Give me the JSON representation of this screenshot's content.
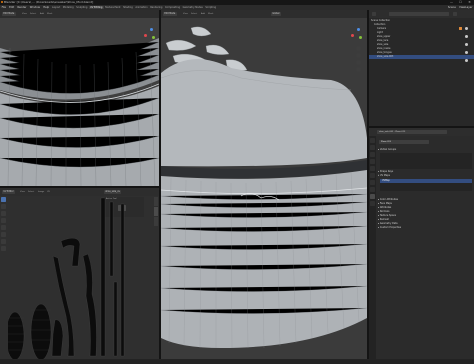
{
  "window": {
    "title": "Blender [C:\\Users\\ ... \\Downloads\\sneaker\\Shoe_Mod.blend]",
    "controls": [
      "—",
      "☐",
      "✕"
    ]
  },
  "menu": [
    "File",
    "Edit",
    "Render",
    "Window",
    "Help"
  ],
  "workspaces": [
    "Layout",
    "Modeling",
    "Sculpting",
    "UV Editing",
    "Texture Paint",
    "Shading",
    "Animation",
    "Rendering",
    "Compositing",
    "Geometry Nodes",
    "Scripting"
  ],
  "active_workspace": "UV Editing",
  "scene": {
    "label": "Scene",
    "view_layer": "ViewLayer"
  },
  "viewport_left": {
    "mode": "Edit Mode",
    "menus": [
      "View",
      "Select",
      "Add",
      "Mesh",
      "Vertex",
      "Edge",
      "Face",
      "UV"
    ],
    "info": "User Perspective",
    "object_info": "(1) shoe_sole.003"
  },
  "viewport_main": {
    "mode": "Edit Mode",
    "menus": [
      "View",
      "Select",
      "Add",
      "Mesh",
      "Vertex",
      "Edge",
      "Face",
      "UV"
    ],
    "shading": "Global"
  },
  "uv_editor": {
    "mode": "UV Editor",
    "menus": [
      "View",
      "Select",
      "Image",
      "UV"
    ],
    "image_name": "shoe_sole_uv",
    "panel_tabs": [
      "Image",
      "Tool",
      "View"
    ],
    "panel_title": "Active Tool"
  },
  "outliner": {
    "search_placeholder": "",
    "rows": [
      {
        "label": "Scene Collection",
        "icon": "collection-icon"
      },
      {
        "label": "Collection",
        "icon": "collection-icon"
      },
      {
        "label": "Camera",
        "icon": "camera-icon"
      },
      {
        "label": "Light",
        "icon": "light-icon"
      },
      {
        "label": "shoe_upper",
        "icon": "mesh-icon"
      },
      {
        "label": "shoe_lace",
        "icon": "mesh-icon"
      },
      {
        "label": "shoe_sole",
        "icon": "mesh-icon"
      },
      {
        "label": "shoe_insole",
        "icon": "mesh-icon"
      },
      {
        "label": "shoe_tongue",
        "icon": "mesh-icon"
      },
      {
        "label": "shoe_sole.003",
        "icon": "mesh-icon"
      }
    ]
  },
  "properties": {
    "breadcrumb": "shoe_sole.003 › Plane.013",
    "data_name": "Plane.013",
    "groups": [
      "Vertex Groups",
      "Shape Keys",
      "UV Maps",
      "Color Attributes",
      "Face Maps",
      "Attributes",
      "Normals",
      "Texture Space",
      "Remesh",
      "Geometry Data",
      "Custom Properties"
    ],
    "uv_map_item": "UVMap"
  },
  "colors": {
    "accent": "#4a72b0",
    "bg": "#1d1d1d",
    "header": "#2d2d2d",
    "x_axis": "#e0474c",
    "y_axis": "#85c33a",
    "z_axis": "#4d8ee6"
  }
}
